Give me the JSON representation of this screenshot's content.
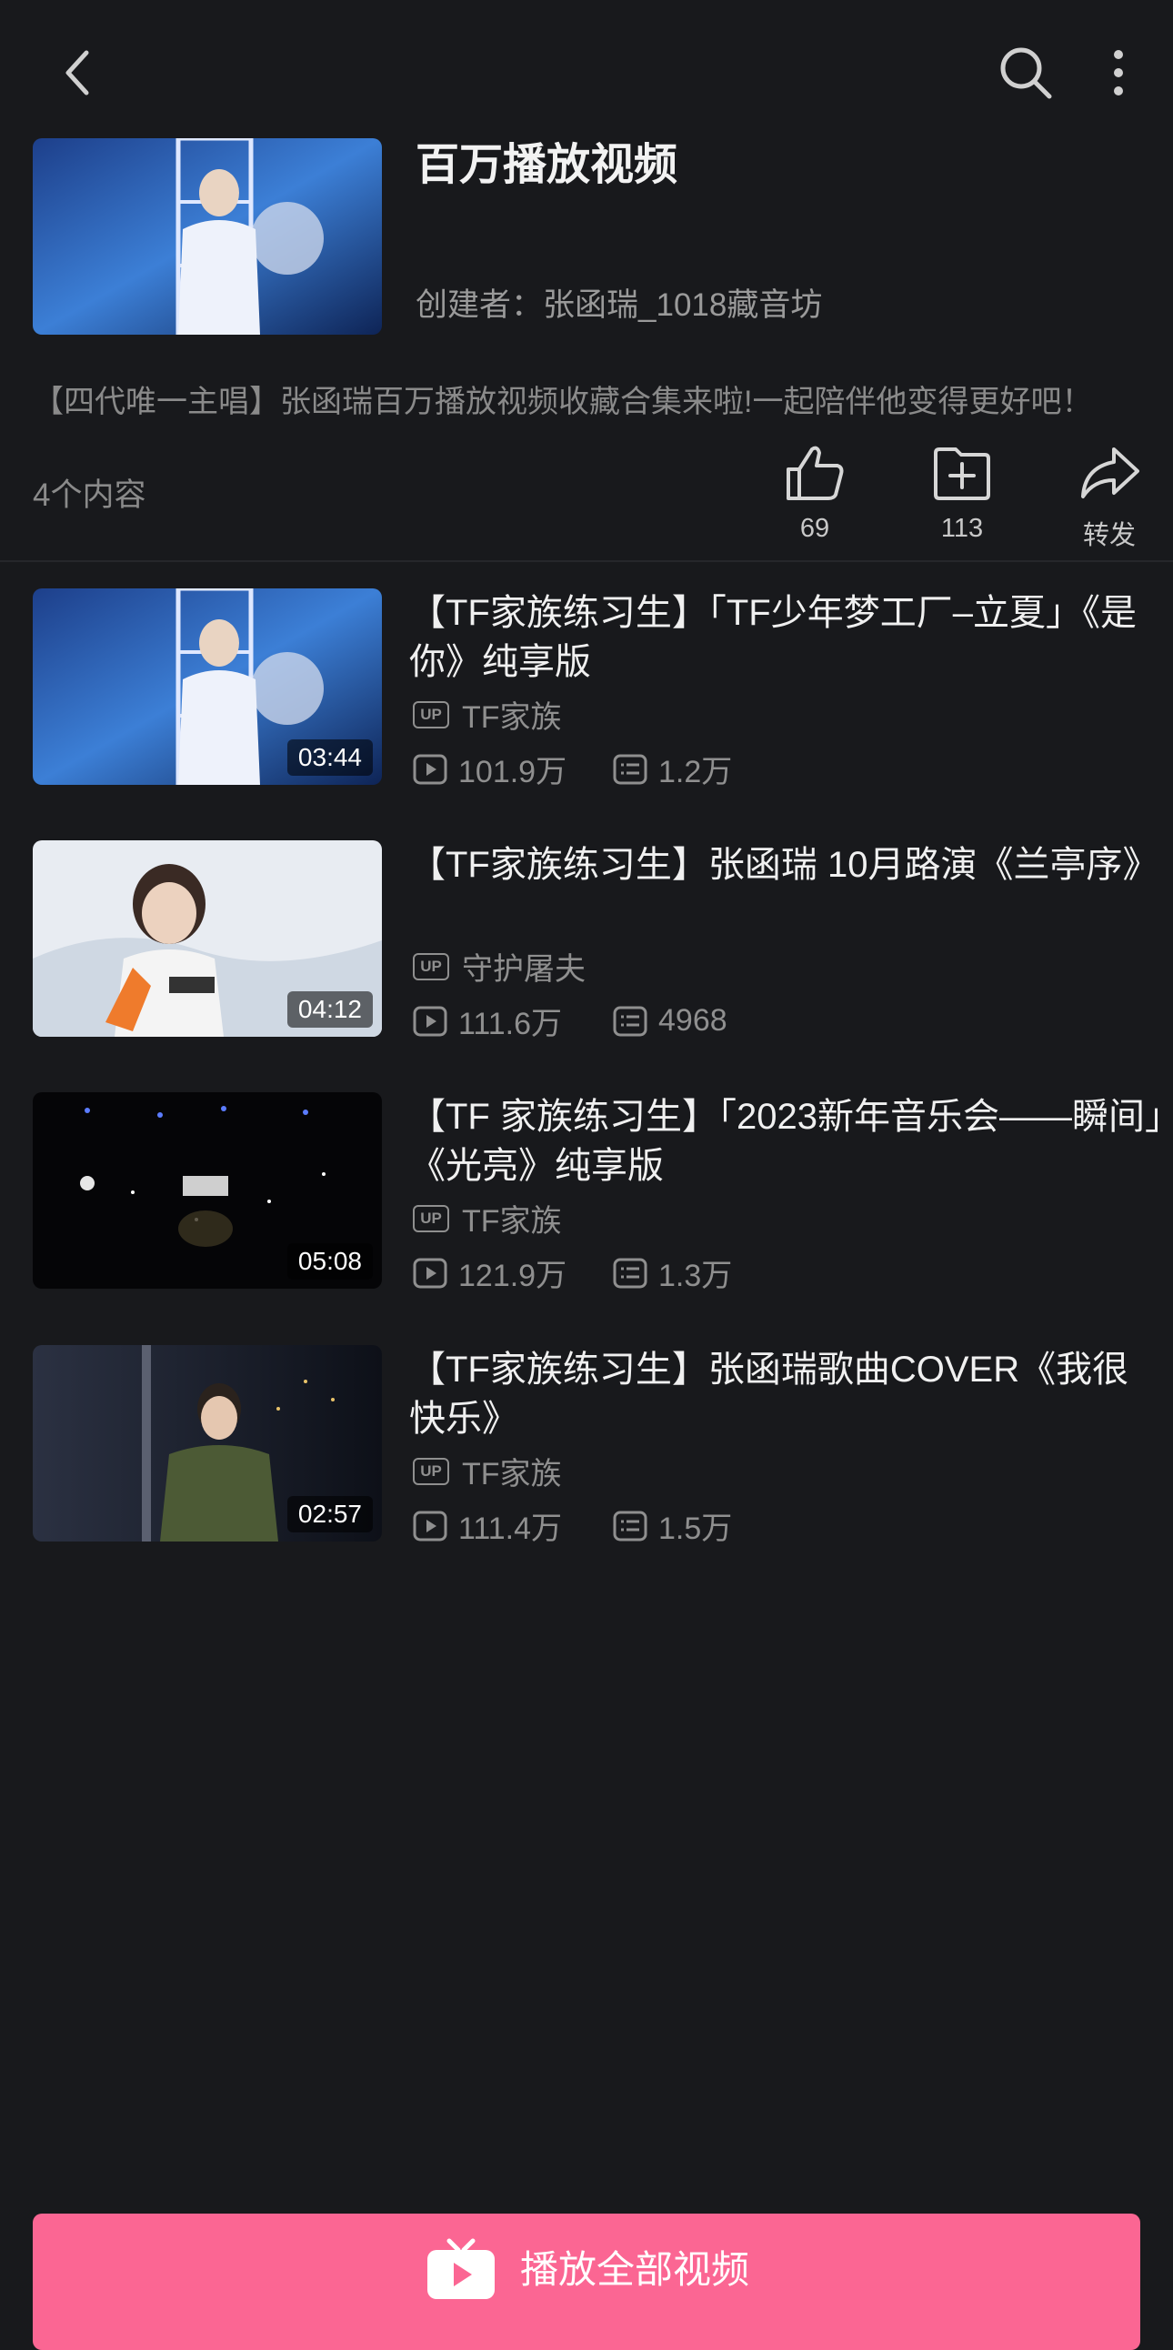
{
  "topbar": {
    "back_icon": "back-icon",
    "search_icon": "search-icon",
    "more_icon": "more-icon"
  },
  "header": {
    "title": "百万播放视频",
    "creator_prefix": "创建者：",
    "creator_name": "张函瑞_1018藏音坊"
  },
  "description": "【四代唯一主唱】张函瑞百万播放视频收藏合集来啦!一起陪伴他变得更好吧！",
  "content_count": "4个内容",
  "actions": [
    {
      "icon": "like-icon",
      "label": "69"
    },
    {
      "icon": "favorite-icon",
      "label": "113"
    },
    {
      "icon": "share-icon",
      "label": "转发"
    }
  ],
  "videos": [
    {
      "title": "【TF家族练习生】「TF少年梦工厂–立夏」《是你》纯享版",
      "uploader": "TF家族",
      "plays": "101.9万",
      "danmaku": "1.2万",
      "duration": "03:44"
    },
    {
      "title": "【TF家族练习生】张函瑞  10月路演《兰亭序》",
      "uploader": "守护屠夫",
      "plays": "111.6万",
      "danmaku": "4968",
      "duration": "04:12"
    },
    {
      "title": "【TF  家族练习生】「2023新年音乐会——瞬间」《光亮》纯享版",
      "uploader": "TF家族",
      "plays": "121.9万",
      "danmaku": "1.3万",
      "duration": "05:08"
    },
    {
      "title": "【TF家族练习生】张函瑞歌曲COVER《我很快乐》",
      "uploader": "TF家族",
      "plays": "111.4万",
      "danmaku": "1.5万",
      "duration": "02:57"
    }
  ],
  "badge_up": "UP",
  "play_all_label": "播放全部视频",
  "colors": {
    "background": "#18191c",
    "accent": "#fb6693",
    "muted_text": "#8f8f8f"
  }
}
